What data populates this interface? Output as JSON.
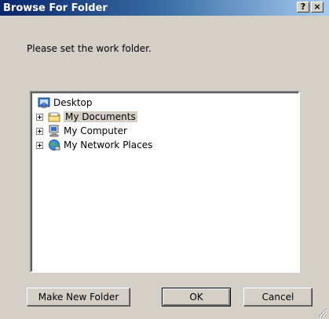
{
  "window": {
    "title": "Browse For Folder",
    "help_label": "?",
    "close_label": "×"
  },
  "instruction": "Please set the work folder.",
  "tree": {
    "root": {
      "label": "Desktop",
      "icon": "desktop-icon"
    },
    "children": [
      {
        "label": "My Documents",
        "icon": "folder-icon",
        "selected": true
      },
      {
        "label": "My Computer",
        "icon": "computer-icon"
      },
      {
        "label": "My Network Places",
        "icon": "network-places-icon"
      }
    ]
  },
  "buttons": {
    "make_new_folder": "Make New Folder",
    "ok": "OK",
    "cancel": "Cancel"
  }
}
